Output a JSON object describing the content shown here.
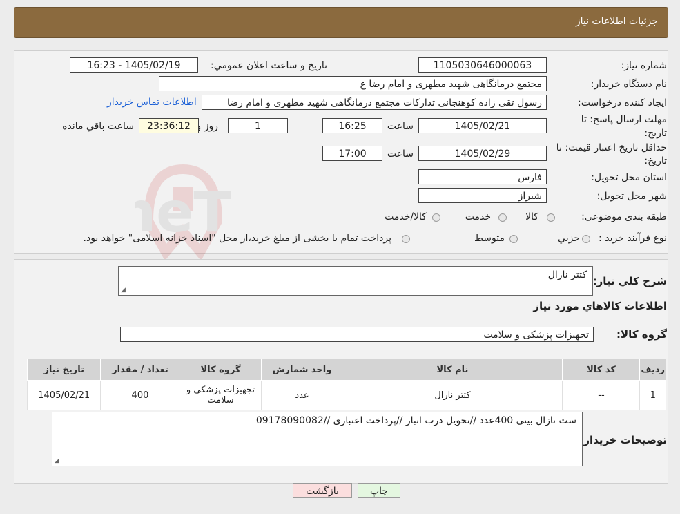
{
  "header": {
    "title": "جزئیات اطلاعات نیاز"
  },
  "form": {
    "need_no_label": "شماره نیاز:",
    "need_no": "1105030646000063",
    "announce_label": "تاريخ و ساعت اعلان عمومي:",
    "announce_value": "1405/02/19 - 16:23",
    "buyer_label": "نام دستگاه خريدار:",
    "buyer_value": "مجتمع درمانگاهی شهید مطهری و امام رضا  ع",
    "creator_label": "ايجاد کننده درخواست:",
    "creator_value": "رسول تقی زاده کوهنجانی تدارکات مجتمع درمانگاهی شهید مطهری و امام رضا",
    "contact_link": "اطلاعات تماس خريدار",
    "deadline_label_1": "مهلت ارسال پاسخ: تا",
    "deadline_label_2": "تاريخ:",
    "deadline_date": "1405/02/21",
    "time_label": "ساعت",
    "deadline_time": "16:25",
    "days_value": "1",
    "days_label": "روز و",
    "remaining_value": "23:36:12",
    "remaining_label": "ساعت باقي مانده",
    "validity_label_1": "حداقل تاريخ اعتبار قيمت: تا",
    "validity_label_2": "تاريخ:",
    "validity_date": "1405/02/29",
    "validity_time": "17:00",
    "province_label": "استان محل تحويل:",
    "province_value": "فارس",
    "city_label": "شهر محل تحويل:",
    "city_value": "شیراز",
    "category_label": "طبقه بندی موضوعی:",
    "category_options": [
      "کالا",
      "خدمت",
      "کالا/خدمت"
    ],
    "process_label": "نوع فرآيند خريد :",
    "process_options": [
      "جزيي",
      "متوسط"
    ],
    "process_note": "پرداخت تمام يا بخشی از مبلغ خريد،از محل \"اسناد خزانه اسلامی\" خواهد بود."
  },
  "details": {
    "summary_label": "شرح کلي نياز:",
    "summary_value": "کتتر نازال",
    "items_heading": "اطلاعات کالاهاي مورد نياز",
    "group_label": "گروه کالا:",
    "group_value": "تجهیزات پزشکی و سلامت",
    "table": {
      "headers": [
        "رديف",
        "کد کالا",
        "نام کالا",
        "واحد شمارش",
        "گروه کالا",
        "تعداد / مقدار",
        "تاريخ نياز"
      ],
      "rows": [
        [
          "1",
          "--",
          "کتتر نازال",
          "عدد",
          "تجهیزات پزشکی و سلامت",
          "400",
          "1405/02/21"
        ]
      ]
    },
    "buyer_notes_label": "توضيحات خريدار:",
    "buyer_notes_value": "ست نازال بینی 400عدد //تحویل درب انبار //پرداخت اعتباری //09178090082"
  },
  "buttons": {
    "print": "چاپ",
    "back": "بازگشت"
  },
  "colors": {
    "header_bg": "#8b6a3e",
    "link": "#1a5fd6",
    "back_btn_bg": "#fbdede",
    "print_btn_bg": "#e4f7e0"
  }
}
